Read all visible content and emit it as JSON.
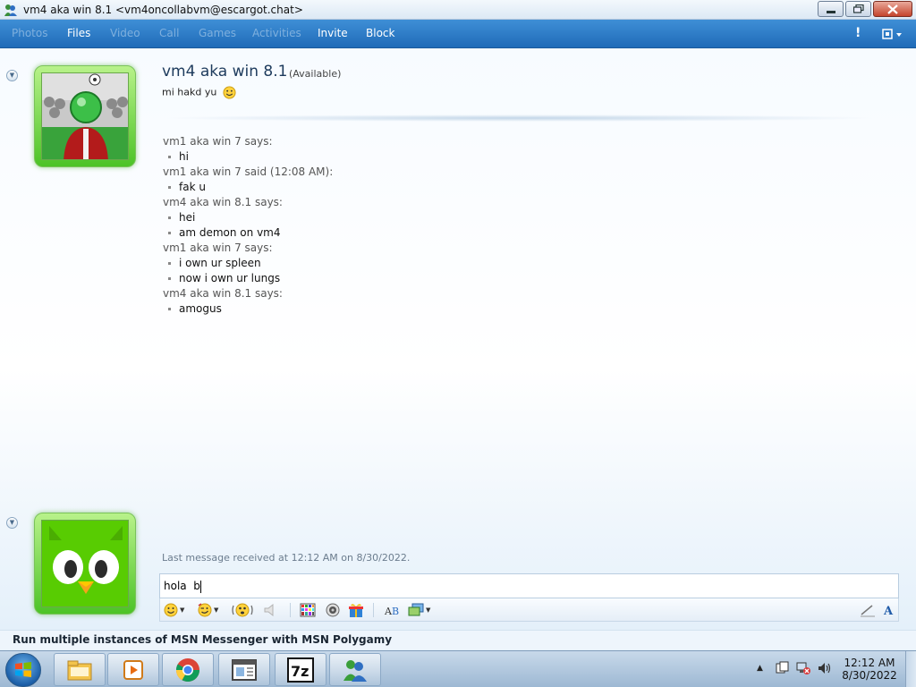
{
  "window": {
    "title": "vm4 aka win 8.1 <vm4oncollabvm@escargot.chat>"
  },
  "menu": {
    "items": [
      {
        "label": "Photos",
        "enabled": false
      },
      {
        "label": "Files",
        "enabled": true
      },
      {
        "label": "Video",
        "enabled": false
      },
      {
        "label": "Call",
        "enabled": false
      },
      {
        "label": "Games",
        "enabled": false
      },
      {
        "label": "Activities",
        "enabled": false
      },
      {
        "label": "Invite",
        "enabled": true
      },
      {
        "label": "Block",
        "enabled": true
      }
    ],
    "alert_icon": "exclamation-icon",
    "options_icon": "menu-options-icon"
  },
  "contact": {
    "name": "vm4 aka win 8.1",
    "status": "(Available)",
    "personal_message": "mi hakd yu",
    "avatar_icon": "soccer-player-avatar"
  },
  "conversation": [
    {
      "header": "vm1 aka win 7 says:",
      "lines": [
        "hi"
      ]
    },
    {
      "header": "vm1 aka win 7 said (12:08 AM):",
      "lines": [
        "fak u"
      ]
    },
    {
      "header": "vm4 aka win 8.1 says:",
      "lines": [
        "hei",
        "am demon on vm4"
      ]
    },
    {
      "header": "vm1 aka win 7 says:",
      "lines": [
        "i own ur spleen",
        "now i own ur lungs"
      ]
    },
    {
      "header": "vm4 aka win 8.1 says:",
      "lines": [
        "amogus"
      ]
    }
  ],
  "footer": {
    "last_message": "Last message received at 12:12 AM on 8/30/2022.",
    "input_value": "hola  b",
    "self_avatar_icon": "owl-avatar"
  },
  "ad": {
    "text": "Run multiple instances of MSN Messenger with MSN Polygamy"
  },
  "taskbar": {
    "apps": [
      "file-explorer-icon",
      "media-player-icon",
      "chrome-icon",
      "window-app-icon",
      "7zip-icon",
      "msn-messenger-icon"
    ],
    "clock_time": "12:12 AM",
    "clock_date": "8/30/2022"
  },
  "colors": {
    "menubar": "#2b7ac6",
    "avatar_green": "#4cc326",
    "accent": "#1d3a5c"
  }
}
